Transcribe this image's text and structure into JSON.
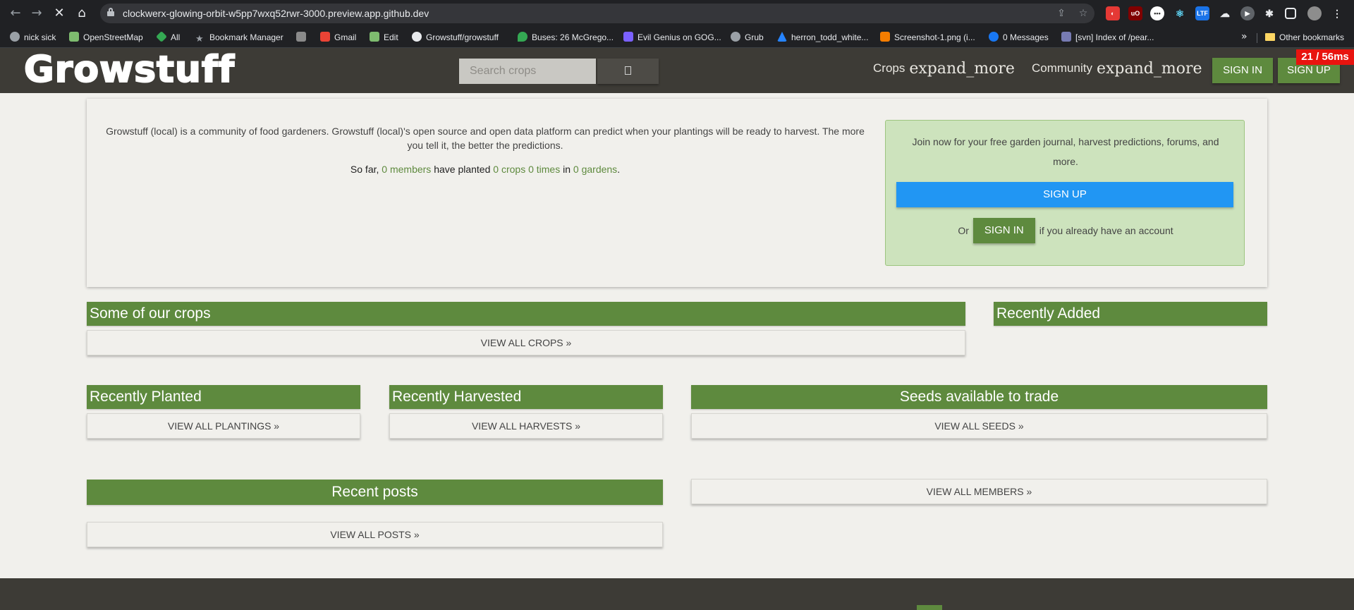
{
  "browser": {
    "url": "clockwerx-glowing-orbit-w5pp7wxq52rwr-3000.preview.app.github.dev",
    "bookmarks": [
      {
        "label": "nick sick",
        "color": "#9aa0a6"
      },
      {
        "label": "OpenStreetMap",
        "color": "#7ebc6f"
      },
      {
        "label": "All",
        "color": "#34a853"
      },
      {
        "label": "Bookmark Manager",
        "color": "#9aa0a6"
      },
      {
        "label": "",
        "color": "#8a8a8a"
      },
      {
        "label": "Gmail",
        "color": "#ea4335"
      },
      {
        "label": "Edit",
        "color": "#7ebc6f"
      },
      {
        "label": "Growstuff/growstuff",
        "color": "#e8eaed"
      },
      {
        "label": "Buses: 26 McGrego...",
        "color": "#34a853"
      },
      {
        "label": "Evil Genius on GOG...",
        "color": "#7b61ff"
      },
      {
        "label": "Grub",
        "color": "#9aa0a6"
      },
      {
        "label": "herron_todd_white...",
        "color": "#2684ff"
      },
      {
        "label": "Screenshot-1.png (i...",
        "color": "#f57d00"
      },
      {
        "label": "0 Messages",
        "color": "#1877f2"
      },
      {
        "label": "[svn] Index of /pear...",
        "color": "#777bb3"
      }
    ],
    "other_bookmarks": "Other bookmarks",
    "perf_badge": "21 / 56ms"
  },
  "nav": {
    "logo": "Growstuff",
    "search_placeholder": "Search crops",
    "crops": "Crops",
    "community": "Community",
    "expand_ligature": "expand_more",
    "sign_in": "SIGN IN",
    "sign_up": "SIGN UP"
  },
  "hero": {
    "intro": "Growstuff (local) is a community of food gardeners. Growstuff (local)'s open source and open data platform can predict when your plantings will be ready to harvest. The more you tell it, the better the predictions.",
    "stats": {
      "prefix": "So far,",
      "members": "0 members",
      "have_planted": "have planted",
      "crops": "0 crops",
      "times": "0 times",
      "in": "in",
      "gardens": "0 gardens",
      "suffix": "."
    },
    "join": {
      "text": "Join now for your free garden journal, harvest predictions, forums, and more.",
      "sign_up": "SIGN UP",
      "or": "Or",
      "sign_in": "SIGN IN",
      "already": "if you already have an account"
    }
  },
  "sections": {
    "some_crops": {
      "title": "Some of our crops",
      "button": "VIEW ALL CROPS »"
    },
    "recently_added": {
      "title": "Recently Added"
    },
    "recently_planted": {
      "title": "Recently Planted",
      "button": "VIEW ALL PLANTINGS »"
    },
    "recently_harvested": {
      "title": "Recently Harvested",
      "button": "VIEW ALL HARVESTS »"
    },
    "seeds": {
      "title": "Seeds available to trade",
      "button": "VIEW ALL SEEDS »"
    },
    "recent_posts": {
      "title": "Recent posts",
      "button": "VIEW ALL POSTS »"
    },
    "members": {
      "button": "VIEW ALL MEMBERS »"
    }
  },
  "colors": {
    "brand_green": "#5e8a3e",
    "navbar": "#3d3b36",
    "join_box": "#cde3bd",
    "primary_blue": "#2196f3"
  }
}
